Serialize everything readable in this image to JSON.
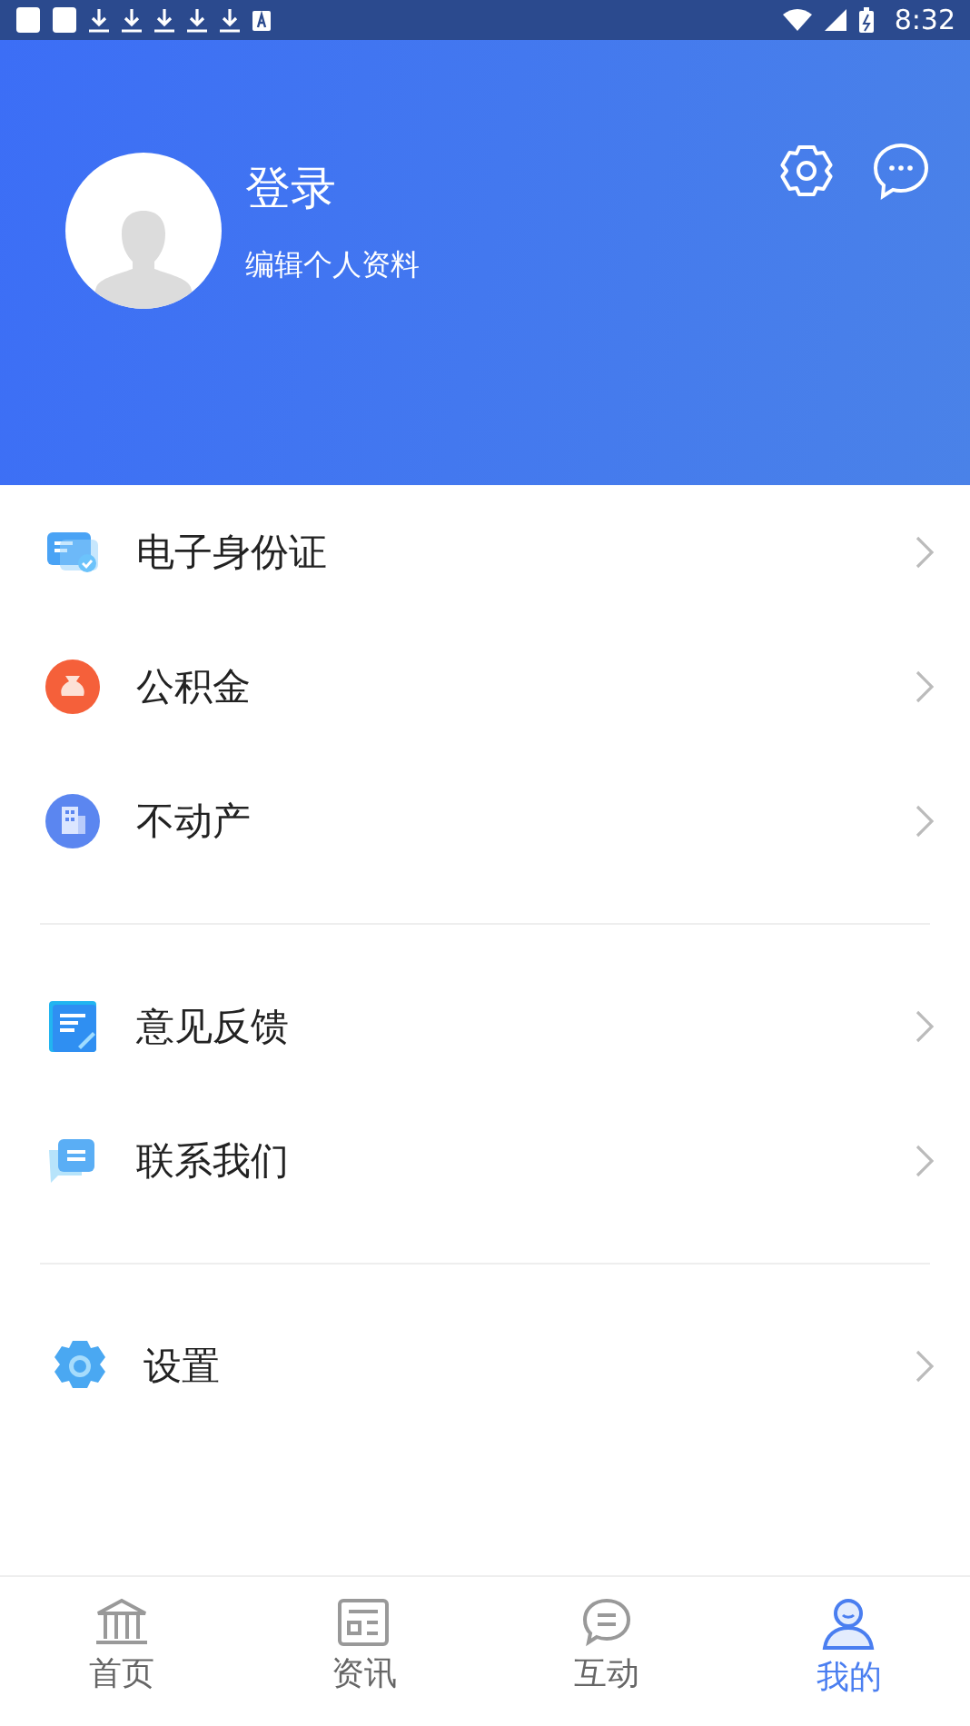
{
  "status_bar": {
    "time": "8:32"
  },
  "profile": {
    "name": "登录",
    "subtitle": "编辑个人资料"
  },
  "menu_groups": [
    [
      {
        "label": "电子身份证"
      },
      {
        "label": "公积金"
      },
      {
        "label": "不动产"
      }
    ],
    [
      {
        "label": "意见反馈"
      },
      {
        "label": "联系我们"
      }
    ],
    [
      {
        "label": "设置"
      }
    ]
  ],
  "tabs": [
    {
      "label": "首页",
      "selected": false
    },
    {
      "label": "资讯",
      "selected": false
    },
    {
      "label": "互动",
      "selected": false
    },
    {
      "label": "我的",
      "selected": true
    }
  ]
}
